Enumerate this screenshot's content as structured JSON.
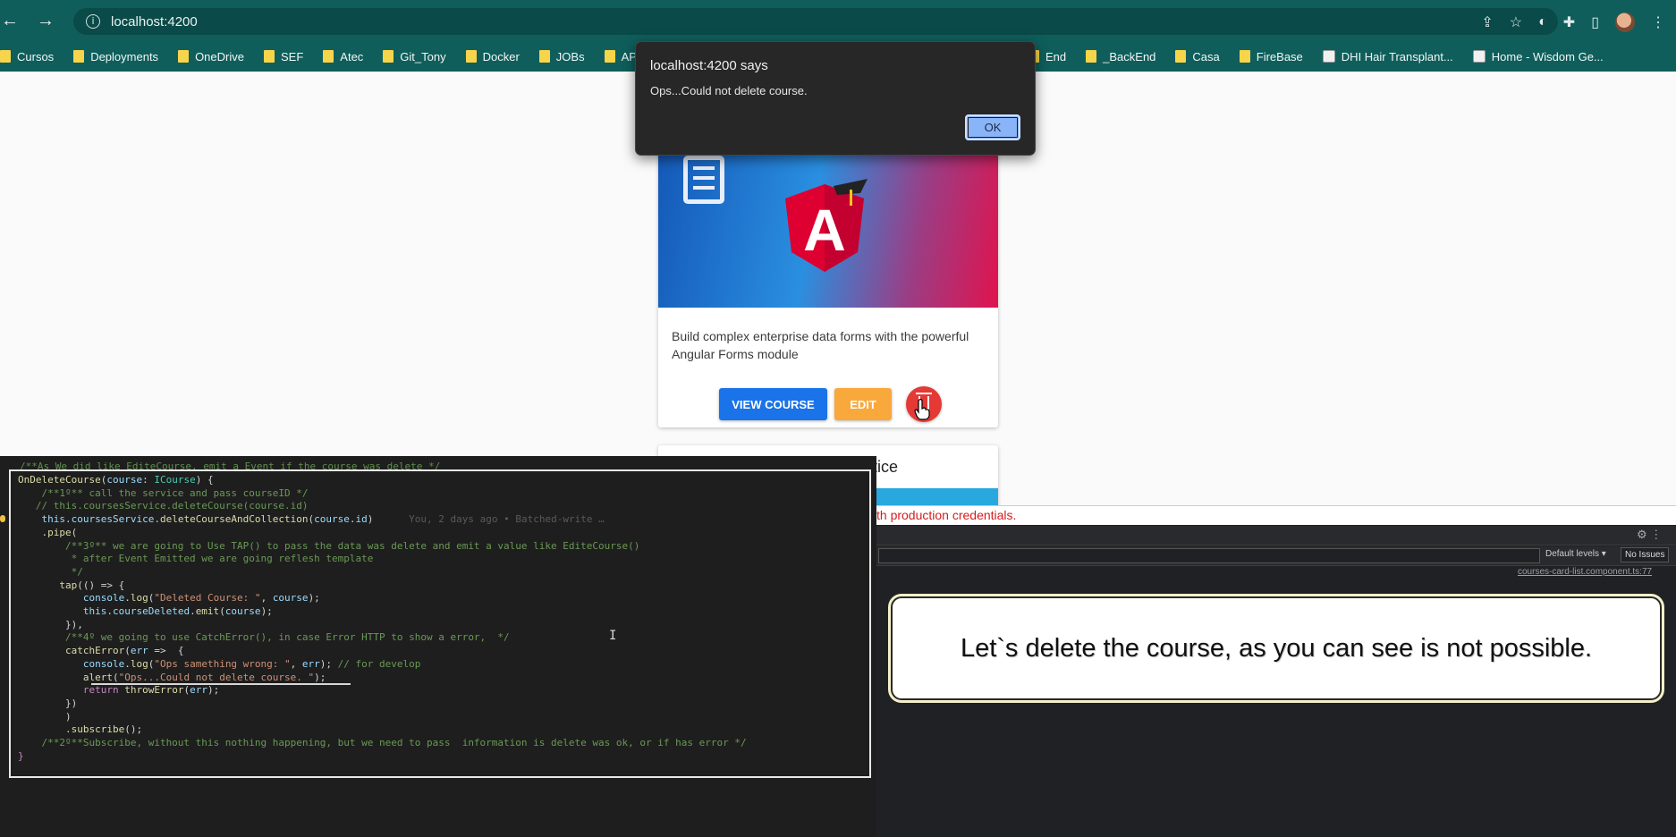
{
  "browser": {
    "nav": {
      "back": "←",
      "forward": "→",
      "reload": "⟳"
    },
    "url": "localhost:4200",
    "info_icon": "i",
    "right_icons": [
      "share-icon",
      "star-icon",
      "extension-icon",
      "puzzle-icon",
      "sidepanel-icon",
      "profile-avatar",
      "menu-icon"
    ]
  },
  "bookmarks": [
    {
      "label": "Cursos",
      "type": "folder"
    },
    {
      "label": "Deployments",
      "type": "folder"
    },
    {
      "label": "OneDrive",
      "type": "folder"
    },
    {
      "label": "SEF",
      "type": "folder"
    },
    {
      "label": "Atec",
      "type": "folder"
    },
    {
      "label": "Git_Tony",
      "type": "folder"
    },
    {
      "label": "Docker",
      "type": "folder"
    },
    {
      "label": "JOBs",
      "type": "folder"
    },
    {
      "label": "APIs_para_Co",
      "type": "folder"
    }
  ],
  "bookmarks_right": [
    {
      "label": "End",
      "type": "folder"
    },
    {
      "label": "_BackEnd",
      "type": "folder"
    },
    {
      "label": "Casa",
      "type": "folder"
    },
    {
      "label": "FireBase",
      "type": "folder"
    },
    {
      "label": "DHI Hair Transplant...",
      "type": "site"
    },
    {
      "label": "Home - Wisdom Ge...",
      "type": "site"
    }
  ],
  "alert": {
    "title": "localhost:4200 says",
    "message": "Ops...Could not delete course.",
    "ok_label": "OK"
  },
  "course_card": {
    "description": "Build complex enterprise data forms with the powerful Angular Forms module",
    "view_label": "VIEW COURSE",
    "edit_label": "EDIT",
    "logo_letter": "A",
    "colors": {
      "view": "#1a73e8",
      "edit": "#f9a93c",
      "delete": "#e53935"
    }
  },
  "course_card_2": {
    "title_fragment": "tice"
  },
  "devtools": {
    "error_fragment": "th production credentials.",
    "default_levels": "Default levels ▾",
    "no_issues": "No Issues",
    "source_link": "courses-card-list.component.ts:77"
  },
  "code": {
    "top_comment": "/**As We did like EditeCourse, emit a Event if the course was delete */",
    "lines": [
      [
        {
          "t": "OnDeleteCourse",
          "c": "fn"
        },
        {
          "t": "(",
          "c": "pl"
        },
        {
          "t": "course",
          "c": "var"
        },
        {
          "t": ": ",
          "c": "pl"
        },
        {
          "t": "ICourse",
          "c": "type"
        },
        {
          "t": ") {",
          "c": "pl"
        }
      ],
      [
        {
          "t": "    /**1º** call the service and pass courseID */",
          "c": "cm"
        }
      ],
      [
        {
          "t": "   // this.coursesService.deleteCourse(course.id)",
          "c": "cm"
        }
      ],
      [
        {
          "t": "    this",
          "c": "var"
        },
        {
          "t": ".",
          "c": "pl"
        },
        {
          "t": "coursesService",
          "c": "var"
        },
        {
          "t": ".",
          "c": "pl"
        },
        {
          "t": "deleteCourseAndCollection",
          "c": "fn"
        },
        {
          "t": "(",
          "c": "pl"
        },
        {
          "t": "course",
          "c": "var"
        },
        {
          "t": ".",
          "c": "pl"
        },
        {
          "t": "id",
          "c": "var"
        },
        {
          "t": ")",
          "c": "pl"
        },
        {
          "t": "      You, 2 days ago • Batched-write …",
          "c": "blame"
        }
      ],
      [
        {
          "t": "    .",
          "c": "pl"
        },
        {
          "t": "pipe",
          "c": "fn"
        },
        {
          "t": "(",
          "c": "pl"
        }
      ],
      [
        {
          "t": "        /**3º** we are going to Use TAP() to pass the data was delete and emit a value like EditeCourse()",
          "c": "cm"
        }
      ],
      [
        {
          "t": "         * after Event Emitted we are going reflesh template",
          "c": "cm"
        }
      ],
      [
        {
          "t": "         */",
          "c": "cm"
        }
      ],
      [
        {
          "t": "       ",
          "c": "pl"
        },
        {
          "t": "tap",
          "c": "fn"
        },
        {
          "t": "(() => {",
          "c": "pl"
        }
      ],
      [
        {
          "t": "           console",
          "c": "var"
        },
        {
          "t": ".",
          "c": "pl"
        },
        {
          "t": "log",
          "c": "fn"
        },
        {
          "t": "(",
          "c": "pl"
        },
        {
          "t": "\"Deleted Course: \"",
          "c": "str"
        },
        {
          "t": ", ",
          "c": "pl"
        },
        {
          "t": "course",
          "c": "var"
        },
        {
          "t": ");",
          "c": "pl"
        }
      ],
      [
        {
          "t": "           this",
          "c": "var"
        },
        {
          "t": ".",
          "c": "pl"
        },
        {
          "t": "courseDeleted",
          "c": "var"
        },
        {
          "t": ".",
          "c": "pl"
        },
        {
          "t": "emit",
          "c": "fn"
        },
        {
          "t": "(",
          "c": "pl"
        },
        {
          "t": "course",
          "c": "var"
        },
        {
          "t": ");",
          "c": "pl"
        }
      ],
      [
        {
          "t": "        }),",
          "c": "pl"
        }
      ],
      [
        {
          "t": "        /**4º we going to use CatchError(), in case Error HTTP to show a error,  */",
          "c": "cm"
        }
      ],
      [
        {
          "t": "        ",
          "c": "pl"
        },
        {
          "t": "catchError",
          "c": "fn"
        },
        {
          "t": "(",
          "c": "pl"
        },
        {
          "t": "err",
          "c": "var"
        },
        {
          "t": " =>  {",
          "c": "pl"
        }
      ],
      [
        {
          "t": "           console",
          "c": "var"
        },
        {
          "t": ".",
          "c": "pl"
        },
        {
          "t": "log",
          "c": "fn"
        },
        {
          "t": "(",
          "c": "pl"
        },
        {
          "t": "\"Ops samething wrong: \"",
          "c": "str"
        },
        {
          "t": ", ",
          "c": "pl"
        },
        {
          "t": "err",
          "c": "var"
        },
        {
          "t": "); ",
          "c": "pl"
        },
        {
          "t": "// for develop",
          "c": "cm"
        }
      ],
      [
        {
          "t": "           ",
          "c": "pl"
        },
        {
          "t": "alert",
          "c": "fn"
        },
        {
          "t": "(",
          "c": "pl"
        },
        {
          "t": "\"Ops...Could not delete course. \"",
          "c": "str"
        },
        {
          "t": ");",
          "c": "pl"
        }
      ],
      [
        {
          "t": "           ",
          "c": "pl"
        },
        {
          "t": "return",
          "c": "kw"
        },
        {
          "t": " ",
          "c": "pl"
        },
        {
          "t": "throwError",
          "c": "fn"
        },
        {
          "t": "(",
          "c": "pl"
        },
        {
          "t": "err",
          "c": "var"
        },
        {
          "t": ");",
          "c": "pl"
        }
      ],
      [
        {
          "t": "        })",
          "c": "pl"
        }
      ],
      [
        {
          "t": "        )",
          "c": "pl"
        }
      ],
      [
        {
          "t": "        .",
          "c": "pl"
        },
        {
          "t": "subscribe",
          "c": "fn"
        },
        {
          "t": "();",
          "c": "pl"
        }
      ],
      [
        {
          "t": "    /**2º**Subscribe, without this nothing happening, but we need to pass  information is delete was ok, or if has error */",
          "c": "cm"
        }
      ],
      [
        {
          "t": "}",
          "c": "kw"
        }
      ]
    ]
  },
  "caption": "Let`s delete the course, as you can see is not possible."
}
